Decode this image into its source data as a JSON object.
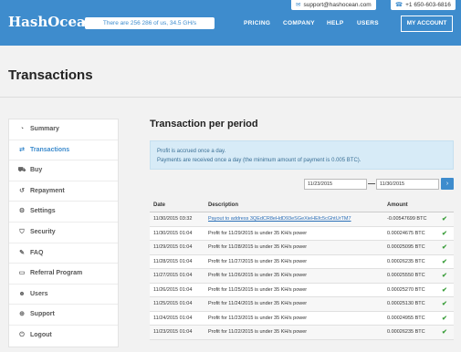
{
  "header": {
    "logo": "HashOcean",
    "hashrate": "There are 256 286 of us, 34.5 GH/s",
    "email": "support@hashocean.com",
    "phone": "+1 650-603-6816",
    "nav": [
      "PRICING",
      "COMPANY",
      "HELP",
      "USERS"
    ],
    "account_label": "MY ACCOUNT"
  },
  "page_title": "Transactions",
  "sidebar": {
    "items": [
      {
        "label": "Summary",
        "icon": "dashboard-icon",
        "active": false
      },
      {
        "label": "Transactions",
        "icon": "exchange-icon",
        "active": true
      },
      {
        "label": "Buy",
        "icon": "cart-icon",
        "active": false
      },
      {
        "label": "Repayment",
        "icon": "history-icon",
        "active": false
      },
      {
        "label": "Settings",
        "icon": "gear-icon",
        "active": false
      },
      {
        "label": "Security",
        "icon": "shield-icon",
        "active": false
      },
      {
        "label": "FAQ",
        "icon": "chat-icon",
        "active": false
      },
      {
        "label": "Referral Program",
        "icon": "card-icon",
        "active": false
      },
      {
        "label": "Users",
        "icon": "users-icon",
        "active": false
      },
      {
        "label": "Support",
        "icon": "lifebuoy-icon",
        "active": false
      },
      {
        "label": "Logout",
        "icon": "logout-icon",
        "active": false
      }
    ]
  },
  "main": {
    "section_title": "Transaction per period",
    "info": [
      "Profit is accrued once a day.",
      "Payments are received once a day (the minimum amount of payment is 0.005 BTC)."
    ],
    "date_from": "11/23/2015",
    "date_to": "11/30/2015",
    "go_icon": "chevron-right-icon"
  },
  "table": {
    "columns": [
      "Date",
      "Description",
      "Amount"
    ],
    "rows": [
      {
        "date": "11/30/2015 03:32",
        "desc": "Payout to address 3QEdCR8eHdD93eSGeXieHEfc5cGhtUrTM7",
        "amount": "-0.00547699 BTC",
        "link": true
      },
      {
        "date": "11/30/2015 01:04",
        "desc": "Profit for 11/29/2015 is under 35 KH/s power",
        "amount": "0.00024675 BTC",
        "link": false
      },
      {
        "date": "11/29/2015 01:04",
        "desc": "Profit for 11/28/2015 is under 35 KH/s power",
        "amount": "0.00025095 BTC",
        "link": false
      },
      {
        "date": "11/28/2015 01:04",
        "desc": "Profit for 11/27/2015 is under 35 KH/s power",
        "amount": "0.00026235 BTC",
        "link": false
      },
      {
        "date": "11/27/2015 01:04",
        "desc": "Profit for 11/26/2015 is under 35 KH/s power",
        "amount": "0.00025550 BTC",
        "link": false
      },
      {
        "date": "11/26/2015 01:04",
        "desc": "Profit for 11/25/2015 is under 35 KH/s power",
        "amount": "0.00025270 BTC",
        "link": false
      },
      {
        "date": "11/25/2015 01:04",
        "desc": "Profit for 11/24/2015 is under 35 KH/s power",
        "amount": "0.00025130 BTC",
        "link": false
      },
      {
        "date": "11/24/2015 01:04",
        "desc": "Profit for 11/23/2015 is under 35 KH/s power",
        "amount": "0.00024955 BTC",
        "link": false
      },
      {
        "date": "11/23/2015 01:04",
        "desc": "Profit for 11/22/2015 is under 35 KH/s power",
        "amount": "0.00026235 BTC",
        "link": false
      }
    ]
  },
  "colors": {
    "brand": "#3e8ccd",
    "info_bg": "#d7ebf7",
    "status": "#3a9d3a"
  }
}
